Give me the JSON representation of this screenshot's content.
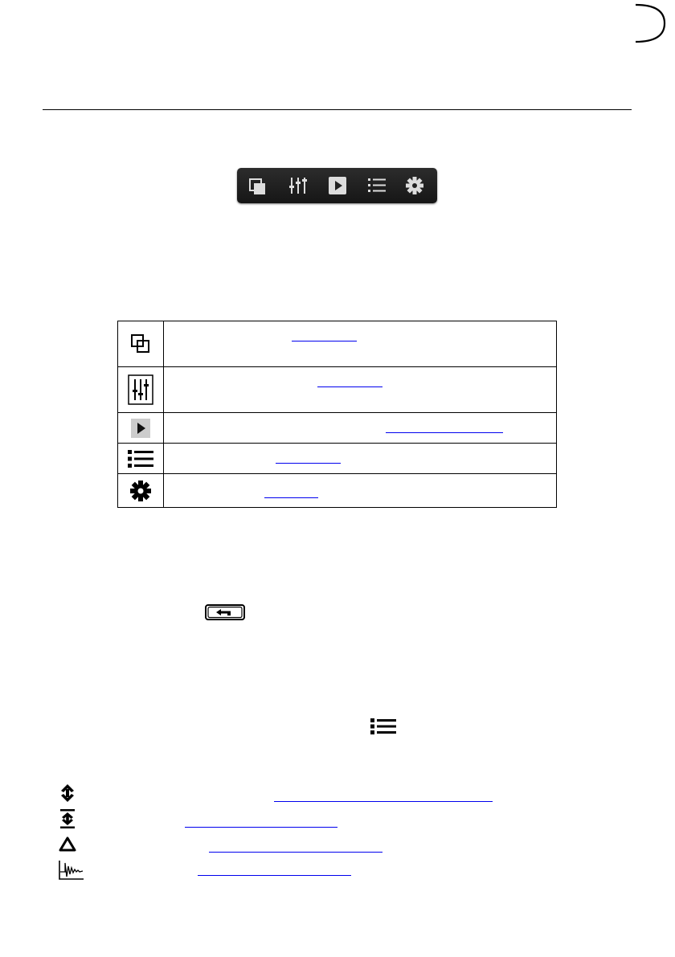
{
  "toolbar": {
    "buttons": [
      {
        "icon": "windows-icon"
      },
      {
        "icon": "sliders-icon"
      },
      {
        "icon": "play-icon"
      },
      {
        "icon": "list-icon"
      },
      {
        "icon": "gear-icon"
      }
    ]
  },
  "icon_table": {
    "rows": [
      {
        "icon": "windows-icon",
        "link_text": ""
      },
      {
        "icon": "sliders-icon",
        "link_text": ""
      },
      {
        "icon": "play-icon",
        "link_text": ""
      },
      {
        "icon": "list-icon",
        "link_text": ""
      },
      {
        "icon": "gear-icon",
        "link_text": ""
      }
    ]
  },
  "keys": {
    "back_key_icon": "return-arrow-icon",
    "menu_icon": "list-icon"
  },
  "modes": [
    {
      "icon": "up-down-arrows-icon",
      "link_text": ""
    },
    {
      "icon": "bar-limits-icon",
      "link_text": ""
    },
    {
      "icon": "triangle-icon",
      "link_text": ""
    },
    {
      "icon": "waveform-icon",
      "link_text": ""
    }
  ],
  "colors": {
    "link": "#0000ee",
    "toolbar_bg": "#1e1e1e"
  }
}
